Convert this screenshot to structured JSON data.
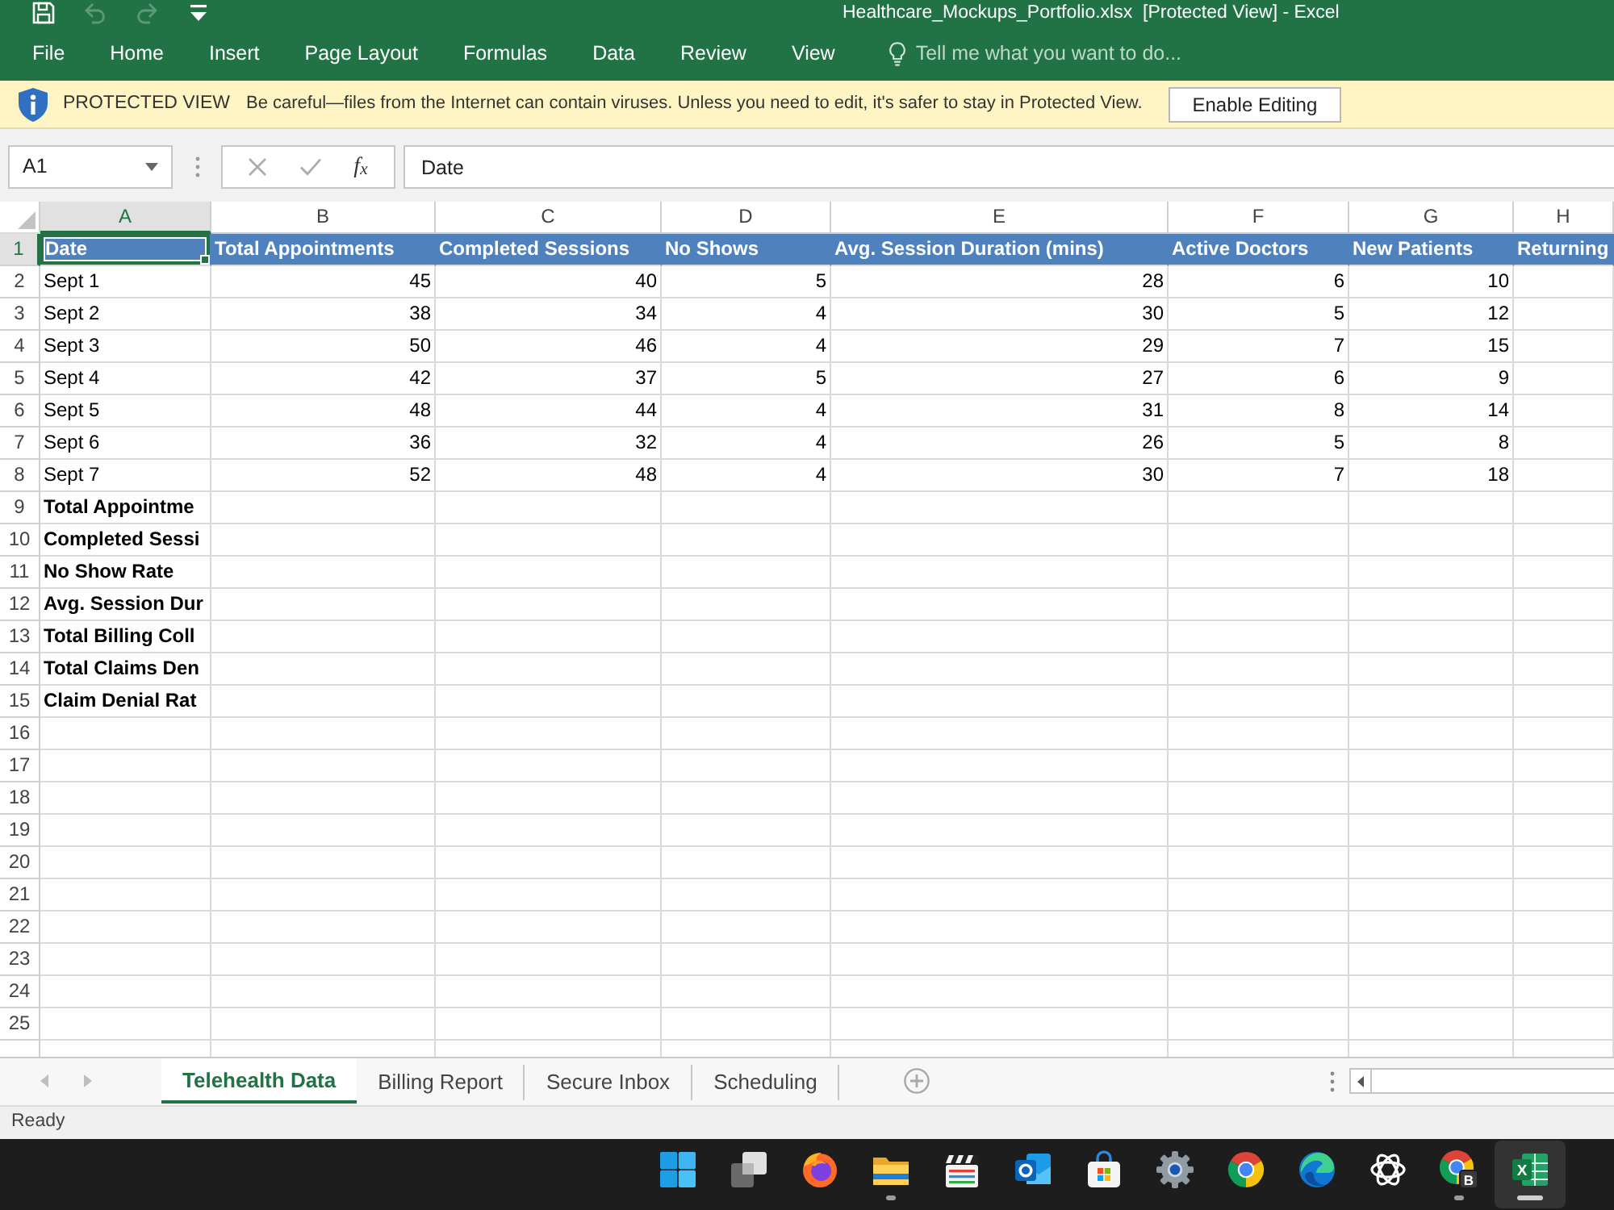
{
  "window": {
    "title": "Healthcare_Mockups_Portfolio.xlsx  [Protected View] - Excel"
  },
  "quick_access": [
    {
      "kind": "save",
      "disabled": false
    },
    {
      "kind": "undo",
      "disabled": true
    },
    {
      "kind": "redo",
      "disabled": true
    },
    {
      "kind": "customize",
      "disabled": false
    }
  ],
  "ribbon_tabs": [
    "File",
    "Home",
    "Insert",
    "Page Layout",
    "Formulas",
    "Data",
    "Review",
    "View"
  ],
  "tell_me": {
    "placeholder": "Tell me what you want to do..."
  },
  "message_bar": {
    "title": "PROTECTED VIEW",
    "text": "Be careful—files from the Internet can contain viruses. Unless you need to edit, it's safer to stay in Protected View.",
    "button": "Enable Editing"
  },
  "formula_bar": {
    "name_box": "A1",
    "buttons": [
      {
        "kind": "cancel",
        "disabled": true
      },
      {
        "kind": "enter",
        "disabled": true
      },
      {
        "kind": "function",
        "label": "f$_{x}$",
        "disabled": false
      }
    ],
    "value": "Date"
  },
  "sheet": {
    "columns": [
      {
        "label": "A",
        "selected": true
      },
      {
        "label": "B",
        "selected": false
      },
      {
        "label": "C",
        "selected": false
      },
      {
        "label": "D",
        "selected": false
      },
      {
        "label": "E",
        "selected": false
      },
      {
        "label": "F",
        "selected": false
      },
      {
        "label": "G",
        "selected": false
      },
      {
        "label": "H",
        "selected": false
      }
    ],
    "rows": [
      {
        "number": "1",
        "selected": true,
        "kind": "header",
        "cells": [
          "Date",
          "Total Appointments",
          "Completed Sessions",
          "No Shows",
          "Avg. Session Duration (mins)",
          "Active Doctors",
          "New Patients",
          "Returning"
        ]
      },
      {
        "number": "2",
        "selected": false,
        "kind": "data",
        "cells": [
          "Sept 1",
          "45",
          "40",
          "5",
          "28",
          "6",
          "10"
        ]
      },
      {
        "number": "3",
        "selected": false,
        "kind": "data",
        "cells": [
          "Sept 2",
          "38",
          "34",
          "4",
          "30",
          "5",
          "12"
        ]
      },
      {
        "number": "4",
        "selected": false,
        "kind": "data",
        "cells": [
          "Sept 3",
          "50",
          "46",
          "4",
          "29",
          "7",
          "15"
        ]
      },
      {
        "number": "5",
        "selected": false,
        "kind": "data",
        "cells": [
          "Sept 4",
          "42",
          "37",
          "5",
          "27",
          "6",
          "9"
        ]
      },
      {
        "number": "6",
        "selected": false,
        "kind": "data",
        "cells": [
          "Sept 5",
          "48",
          "44",
          "4",
          "31",
          "8",
          "14"
        ]
      },
      {
        "number": "7",
        "selected": false,
        "kind": "data",
        "cells": [
          "Sept 6",
          "36",
          "32",
          "4",
          "26",
          "5",
          "8"
        ]
      },
      {
        "number": "8",
        "selected": false,
        "kind": "data",
        "cells": [
          "Sept 7",
          "52",
          "48",
          "4",
          "30",
          "7",
          "18"
        ]
      },
      {
        "number": "9",
        "selected": false,
        "kind": "summary",
        "cells": [
          "Total Appointme"
        ]
      },
      {
        "number": "10",
        "selected": false,
        "kind": "summary",
        "cells": [
          "Completed Sessi"
        ]
      },
      {
        "number": "11",
        "selected": false,
        "kind": "summary",
        "cells": [
          "No Show Rate"
        ]
      },
      {
        "number": "12",
        "selected": false,
        "kind": "summary",
        "cells": [
          "Avg. Session Dur"
        ]
      },
      {
        "number": "13",
        "selected": false,
        "kind": "summary",
        "cells": [
          "Total Billing Coll"
        ]
      },
      {
        "number": "14",
        "selected": false,
        "kind": "summary",
        "cells": [
          "Total Claims Den"
        ]
      },
      {
        "number": "15",
        "selected": false,
        "kind": "summary",
        "cells": [
          "Claim Denial Rat"
        ]
      },
      {
        "number": "16",
        "selected": false,
        "kind": "blank"
      },
      {
        "number": "17",
        "selected": false,
        "kind": "blank"
      },
      {
        "number": "18",
        "selected": false,
        "kind": "blank"
      },
      {
        "number": "19",
        "selected": false,
        "kind": "blank"
      },
      {
        "number": "20",
        "selected": false,
        "kind": "blank"
      },
      {
        "number": "21",
        "selected": false,
        "kind": "blank"
      },
      {
        "number": "22",
        "selected": false,
        "kind": "blank"
      },
      {
        "number": "23",
        "selected": false,
        "kind": "blank"
      },
      {
        "number": "24",
        "selected": false,
        "kind": "blank"
      },
      {
        "number": "25",
        "selected": false,
        "kind": "blank"
      }
    ]
  },
  "sheet_tabs": {
    "scroll_buttons": [
      {
        "kind": "previous",
        "disabled": true
      },
      {
        "kind": "next",
        "disabled": true
      }
    ],
    "tabs": [
      {
        "label": "Telehealth Data",
        "selected": true
      },
      {
        "label": "Billing Report",
        "selected": false
      },
      {
        "label": "Secure Inbox",
        "selected": false
      },
      {
        "label": "Scheduling",
        "selected": false
      }
    ]
  },
  "status_bar": {
    "text": "Ready"
  },
  "taskbar": [
    {
      "kind": "start",
      "running": false,
      "active": false
    },
    {
      "kind": "taskview",
      "running": false,
      "active": false
    },
    {
      "kind": "firefox",
      "running": false,
      "active": false
    },
    {
      "kind": "explorer",
      "running": true,
      "active": false
    },
    {
      "kind": "mediaplayer",
      "running": false,
      "active": false
    },
    {
      "kind": "outlook",
      "running": false,
      "active": false
    },
    {
      "kind": "store",
      "running": false,
      "active": false
    },
    {
      "kind": "settings",
      "running": false,
      "active": false
    },
    {
      "kind": "chrome",
      "running": false,
      "active": false
    },
    {
      "kind": "edge",
      "running": false,
      "active": false
    },
    {
      "kind": "chatgpt",
      "running": false,
      "active": false
    },
    {
      "kind": "chromeprofile",
      "running": true,
      "active": false,
      "letter": "B"
    },
    {
      "kind": "excel",
      "running": true,
      "active": true,
      "letter": "X"
    }
  ]
}
